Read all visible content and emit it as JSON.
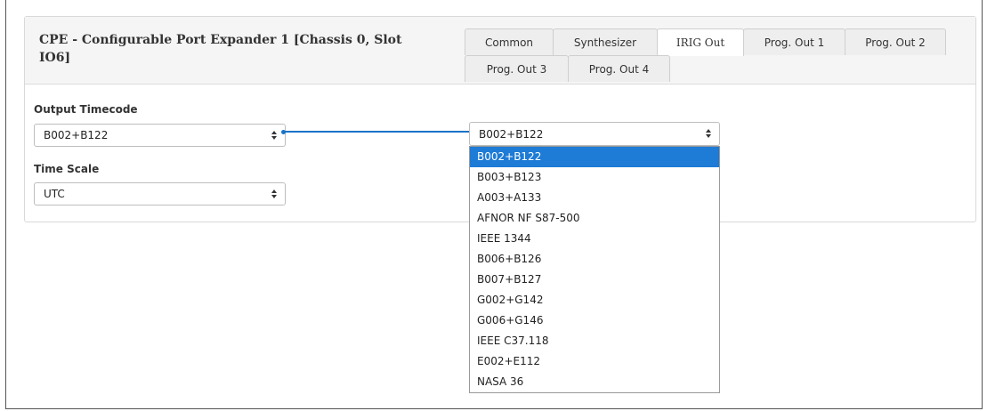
{
  "panel": {
    "title": "CPE - Configurable Port Expander 1 [Chassis 0, Slot IO6]"
  },
  "tabs": [
    {
      "label": "Common"
    },
    {
      "label": "Synthesizer"
    },
    {
      "label": "IRIG Out",
      "active": true
    },
    {
      "label": "Prog. Out 1"
    },
    {
      "label": "Prog. Out 2"
    },
    {
      "label": "Prog. Out 3"
    },
    {
      "label": "Prog. Out 4"
    }
  ],
  "form": {
    "output_timecode": {
      "label": "Output Timecode",
      "value": "B002+B122"
    },
    "time_scale": {
      "label": "Time Scale",
      "value": "UTC"
    }
  },
  "dropdown": {
    "value": "B002+B122",
    "options": [
      "B002+B122",
      "B003+B123",
      "A003+A133",
      "AFNOR NF S87-500",
      "IEEE 1344",
      "B006+B126",
      "B007+B127",
      "G002+G142",
      "G006+G146",
      "IEEE C37.118",
      "E002+E112",
      "NASA 36"
    ],
    "selected_index": 0
  },
  "colors": {
    "accent": "#1e7bd6",
    "connector": "#1a73c8"
  }
}
